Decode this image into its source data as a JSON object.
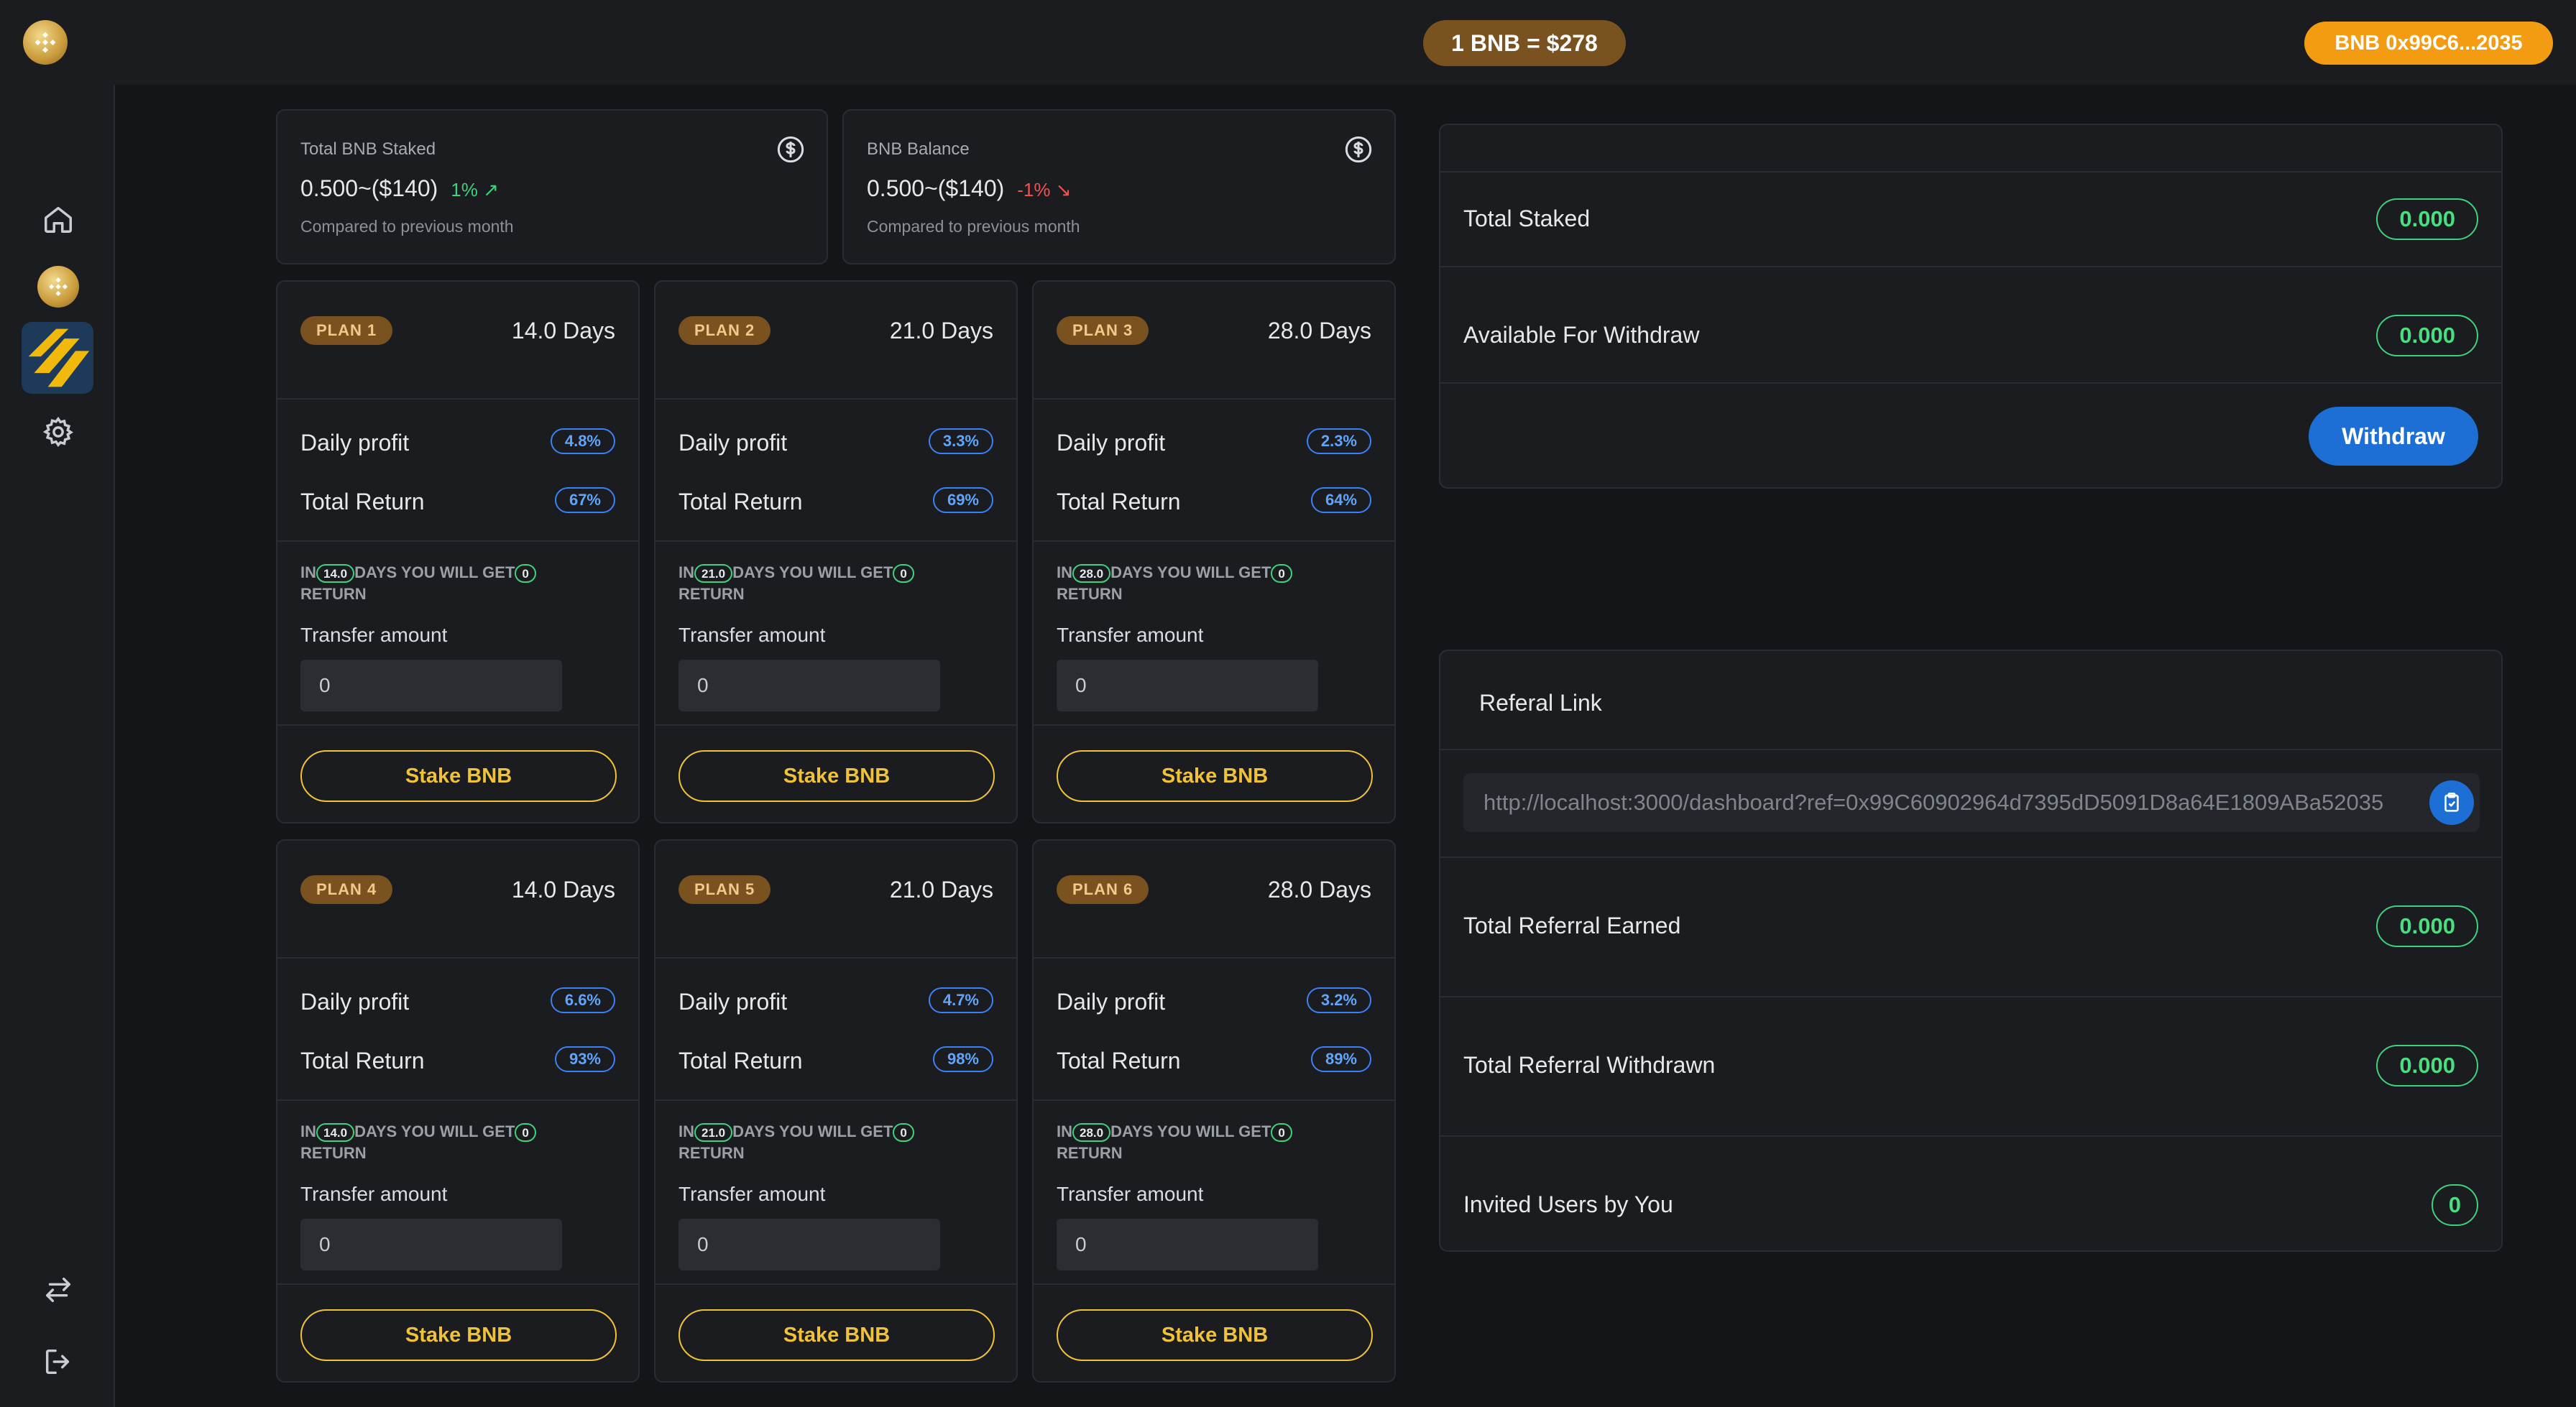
{
  "header": {
    "price": "1 BNB = $278",
    "wallet": "BNB 0x99C6...2035"
  },
  "sidebar": {
    "icons": [
      "home-icon",
      "bnb-coin-icon",
      "binance-logo-icon",
      "gear-icon",
      "swap-icon",
      "logout-icon"
    ]
  },
  "stats": [
    {
      "label": "Total BNB Staked",
      "value": "0.500~($140)",
      "change": "1%",
      "direction": "up",
      "sub": "Compared to previous month"
    },
    {
      "label": "BNB Balance",
      "value": "0.500~($140)",
      "change": "-1%",
      "direction": "down",
      "sub": "Compared to previous month"
    }
  ],
  "plans": [
    {
      "badge": "PLAN 1",
      "days": "14.0 Days",
      "daily_label": "Daily profit",
      "daily": "4.8%",
      "return_label": "Total Return",
      "total": "67%",
      "note_in": "IN",
      "note_days": "14.0",
      "note_mid": "DAYS YOU WILL GET",
      "note_amount": "0",
      "note_end": "RETURN",
      "transfer_label": "Transfer amount",
      "input_value": "0",
      "button": "Stake BNB"
    },
    {
      "badge": "PLAN 2",
      "days": "21.0 Days",
      "daily_label": "Daily profit",
      "daily": "3.3%",
      "return_label": "Total Return",
      "total": "69%",
      "note_in": "IN",
      "note_days": "21.0",
      "note_mid": "DAYS YOU WILL GET",
      "note_amount": "0",
      "note_end": "RETURN",
      "transfer_label": "Transfer amount",
      "input_value": "0",
      "button": "Stake BNB"
    },
    {
      "badge": "PLAN 3",
      "days": "28.0 Days",
      "daily_label": "Daily profit",
      "daily": "2.3%",
      "return_label": "Total Return",
      "total": "64%",
      "note_in": "IN",
      "note_days": "28.0",
      "note_mid": "DAYS YOU WILL GET",
      "note_amount": "0",
      "note_end": "RETURN",
      "transfer_label": "Transfer amount",
      "input_value": "0",
      "button": "Stake BNB"
    },
    {
      "badge": "PLAN 4",
      "days": "14.0 Days",
      "daily_label": "Daily profit",
      "daily": "6.6%",
      "return_label": "Total Return",
      "total": "93%",
      "note_in": "IN",
      "note_days": "14.0",
      "note_mid": "DAYS YOU WILL GET",
      "note_amount": "0",
      "note_end": "RETURN",
      "transfer_label": "Transfer amount",
      "input_value": "0",
      "button": "Stake BNB"
    },
    {
      "badge": "PLAN 5",
      "days": "21.0 Days",
      "daily_label": "Daily profit",
      "daily": "4.7%",
      "return_label": "Total Return",
      "total": "98%",
      "note_in": "IN",
      "note_days": "21.0",
      "note_mid": "DAYS YOU WILL GET",
      "note_amount": "0",
      "note_end": "RETURN",
      "transfer_label": "Transfer amount",
      "input_value": "0",
      "button": "Stake BNB"
    },
    {
      "badge": "PLAN 6",
      "days": "28.0 Days",
      "daily_label": "Daily profit",
      "daily": "3.2%",
      "return_label": "Total Return",
      "total": "89%",
      "note_in": "IN",
      "note_days": "28.0",
      "note_mid": "DAYS YOU WILL GET",
      "note_amount": "0",
      "note_end": "RETURN",
      "transfer_label": "Transfer amount",
      "input_value": "0",
      "button": "Stake BNB"
    }
  ],
  "staking_panel": {
    "total_staked_label": "Total Staked",
    "total_staked": "0.000",
    "available_label": "Available For Withdraw",
    "available": "0.000",
    "withdraw_button": "Withdraw"
  },
  "referral": {
    "title": "Referal Link",
    "link": "http://localhost:3000/dashboard?ref=0x99C60902964d7395dD5091D8a64E1809ABa52035",
    "earned_label": "Total Referral Earned",
    "earned": "0.000",
    "withdrawn_label": "Total Referral Withdrawn",
    "withdrawn": "0.000",
    "invited_label": "Invited Users by You",
    "invited": "0"
  },
  "colors": {
    "background": "#141519",
    "card": "#1b1c20",
    "accent_gold": "#f0c13a",
    "accent_orange": "#f39c12",
    "accent_blue": "#1d6fd6",
    "positive": "#3fd27b",
    "negative": "#f05252"
  }
}
